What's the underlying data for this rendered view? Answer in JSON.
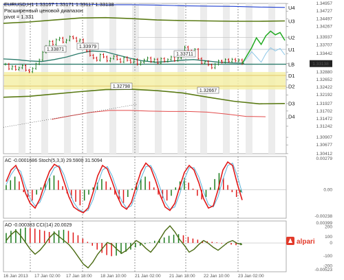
{
  "header": {
    "symbol_line": "EURUSD,H1  1.33167 1.33171 1.33117 1.33138",
    "subtitle": "Расширенный ценовой диапазон",
    "pivot_label": "pivot = 1.331"
  },
  "colors": {
    "price_up": "#1a7a1a",
    "price_down": "#cc0000",
    "forecast": "#22aa22",
    "channel_upper": "#1f3fd0",
    "channel_mid": "#5a7a14",
    "moving_average": "#2a7a6a",
    "pivot_band": "#f5f0a8",
    "red_level": "#e24a4a",
    "ac_signal": "#e01818",
    "cci_line": "#4a6a12"
  },
  "chart_data": [
    {
      "id": "price",
      "type": "line",
      "title": "EURUSD,H1",
      "ylim": [
        1.3041,
        1.3496
      ],
      "yticks": [
        "1.34957",
        "1.34727",
        "1.34497",
        "1.34267",
        "1.33937",
        "1.33707",
        "1.33442",
        "1.33138",
        "1.32880",
        "1.32652",
        "1.32422",
        "1.32192",
        "1.31927",
        "1.31702",
        "1.31472",
        "1.31242",
        "1.30907",
        "1.30677",
        "1.30412"
      ],
      "levels": [
        {
          "name": "U4",
          "value": 1.3484
        },
        {
          "name": "U3",
          "value": 1.3443
        },
        {
          "name": "U2",
          "value": 1.3393
        },
        {
          "name": "U1",
          "value": 1.3357
        },
        {
          "name": "LB",
          "value": 1.3312
        },
        {
          "name": "D1",
          "value": 1.3278
        },
        {
          "name": "D2",
          "value": 1.3246
        },
        {
          "name": "D3",
          "value": 1.3194
        },
        {
          "name": "D4",
          "value": 1.3154
        }
      ],
      "current_price": 1.33138,
      "annotations": [
        {
          "text": "1.33871",
          "value": 1.33871
        },
        {
          "text": "1.33979",
          "value": 1.33979
        },
        {
          "text": "1.33711",
          "value": 1.33711
        },
        {
          "text": "1.32798",
          "value": 1.32798
        },
        {
          "text": "1.32667",
          "value": 1.32667
        }
      ],
      "close": [
        1.3312,
        1.3298,
        1.3305,
        1.3296,
        1.3301,
        1.3308,
        1.3294,
        1.3289,
        1.3299,
        1.3313,
        1.3325,
        1.3348,
        1.3366,
        1.3381,
        1.3372,
        1.3386,
        1.3391,
        1.3379,
        1.3385,
        1.3395,
        1.3391,
        1.3382,
        1.3386,
        1.3368,
        1.3352,
        1.3339,
        1.3331,
        1.3324,
        1.3341,
        1.3334,
        1.3322,
        1.3329,
        1.3336,
        1.3327,
        1.3319,
        1.3332,
        1.3324,
        1.3318,
        1.3326,
        1.3312,
        1.3318,
        1.3325,
        1.3331,
        1.332,
        1.3327,
        1.3315,
        1.3329,
        1.3321,
        1.3326,
        1.3334,
        1.3323,
        1.3331,
        1.3348,
        1.3364,
        1.3352,
        1.3344,
        1.3357,
        1.3329,
        1.3315,
        1.332,
        1.331,
        1.3301,
        1.3312,
        1.3322,
        1.3318,
        1.3326,
        1.332,
        1.3327,
        1.3322,
        1.3325,
        1.3314
      ],
      "forecast": [
        1.3314,
        1.3338,
        1.3362,
        1.3392,
        1.3372,
        1.3398,
        1.3412,
        1.3401,
        1.3408,
        1.3384
      ],
      "forecast_alt": [
        1.3314,
        1.333,
        1.335,
        1.3334,
        1.3318,
        1.3344,
        1.3362,
        1.3352,
        1.336,
        1.334
      ],
      "upper_channel": [
        1.3493,
        1.3494,
        1.3495,
        1.3494,
        1.3492,
        1.3492,
        1.3491,
        1.3489,
        1.3488,
        1.3487,
        1.3485,
        1.3484
      ],
      "mid_channel_high": [
        1.3436,
        1.344,
        1.3446,
        1.3452,
        1.3453,
        1.345,
        1.3446,
        1.3444,
        1.3443,
        1.3442,
        1.3442,
        1.3443
      ],
      "mid_channel_low": [
        1.3212,
        1.3215,
        1.3222,
        1.3229,
        1.3235,
        1.3236,
        1.3232,
        1.3225,
        1.3212,
        1.32,
        1.3192,
        1.3193
      ],
      "red_line": [
        1.3145,
        1.3156,
        1.3166,
        1.3172,
        1.3172,
        1.317,
        1.3169,
        1.3169,
        1.3167,
        1.3161,
        1.3154,
        1.3153
      ],
      "moving_average": [
        1.3328,
        1.3326,
        1.3322,
        1.332,
        1.3326,
        1.3334,
        1.3345,
        1.3352,
        1.335,
        1.334,
        1.333,
        1.3322,
        1.3318,
        1.332,
        1.3324,
        1.3326,
        1.3322,
        1.3318,
        1.3316,
        1.3315
      ]
    },
    {
      "id": "ac_stoch",
      "type": "bar",
      "title": "AC -0.0001686  Stoch(5,3,3) 29.5900 31.5094",
      "ylim": [
        -0.00238,
        0.00279
      ],
      "yticks": [
        "0.00279",
        "0.00",
        "-0.00238"
      ],
      "histogram": [
        0.0004,
        0.0008,
        0.0011,
        0.0007,
        -0.0002,
        -0.0006,
        -0.0009,
        -0.0004,
        0.0002,
        0.0007,
        0.001,
        0.0012,
        0.0008,
        0.0003,
        -0.0003,
        -0.0007,
        -0.001,
        -0.0013,
        -0.0009,
        -0.0004,
        0.0002,
        0.0006,
        0.0009,
        0.0007,
        0.0002,
        -0.0004,
        -0.0008,
        -0.0011,
        -0.0006,
        0.0001,
        0.0006,
        0.0009,
        0.0011,
        0.0007,
        0.0002,
        -0.0004,
        -0.0007,
        -0.0009,
        -0.0005,
        0.0002,
        0.0007,
        0.001,
        0.0006,
        0.0001,
        -0.0005,
        -0.0008,
        -0.0006,
        0.0002,
        0.0009,
        0.0014,
        0.001,
        0.0004,
        -0.0002,
        -0.0006,
        -0.0002
      ],
      "stoch_main": [
        60,
        80,
        88,
        70,
        40,
        22,
        14,
        30,
        56,
        78,
        90,
        85,
        60,
        34,
        16,
        10,
        6,
        14,
        40,
        70,
        88,
        82,
        60,
        36,
        18,
        12,
        24,
        52,
        78,
        92,
        84,
        62,
        36,
        16,
        10,
        22,
        50,
        76,
        88,
        80,
        58,
        30,
        14,
        18,
        46,
        80,
        94,
        88,
        56,
        28
      ],
      "stoch_signal": [
        55,
        72,
        84,
        78,
        52,
        30,
        18,
        24,
        44,
        68,
        84,
        88,
        72,
        46,
        24,
        12,
        8,
        10,
        28,
        56,
        80,
        86,
        70,
        46,
        26,
        14,
        18,
        40,
        66,
        86,
        88,
        72,
        48,
        24,
        12,
        16,
        38,
        64,
        84,
        84,
        68,
        42,
        20,
        16,
        34,
        64,
        88,
        92,
        70,
        40
      ]
    },
    {
      "id": "ao_cci",
      "type": "bar",
      "title": "AO -0.000383  CCI(14) 20.0029",
      "ylim": [
        -0.00523,
        0.00399
      ],
      "yticks": [
        "0.00399",
        "200",
        "100",
        "0",
        "-100",
        "-200",
        "-0.00523"
      ],
      "histogram": [
        0.0018,
        0.0022,
        0.0025,
        0.0026,
        0.0028,
        0.0027,
        0.0026,
        0.0024,
        0.0022,
        0.002,
        0.0021,
        0.0023,
        0.0024,
        0.0022,
        0.0019,
        0.0014,
        0.0008,
        0.0002,
        -0.0005,
        -0.0012,
        -0.0018,
        -0.0022,
        -0.0024,
        -0.0023,
        -0.002,
        -0.0016,
        -0.0012,
        -0.0008,
        -0.0005,
        -0.0002,
        0.0001,
        0.0004,
        0.0007,
        0.001,
        0.0013,
        0.0015,
        0.0016,
        0.0014,
        0.0011,
        0.0008,
        0.0006,
        0.0004,
        0.0003,
        0.0002,
        0.0001,
        -0.0001,
        -0.0002,
        -0.0003,
        -0.0004,
        -0.0004
      ],
      "cci": [
        60,
        120,
        160,
        110,
        40,
        -30,
        -80,
        -40,
        20,
        90,
        140,
        100,
        60,
        20,
        -40,
        -110,
        -180,
        -220,
        -160,
        -80,
        -20,
        40,
        20,
        -30,
        -70,
        -40,
        10,
        60,
        30,
        -20,
        -60,
        0,
        80,
        160,
        210,
        150,
        70,
        10,
        -60,
        -30,
        20,
        60,
        30,
        -10,
        -40,
        0,
        40,
        60,
        30,
        20
      ]
    }
  ],
  "time_axis": {
    "labels": [
      "16 Jan 2013",
      "17 Jan 02:00",
      "17 Jan 18:00",
      "18 Jan 10:00",
      "21 Jan 02:00",
      "21 Jan 18:00",
      "22 Jan 10:00",
      "23 Jan 02:00"
    ]
  },
  "branding": {
    "logo_text": "alpari",
    "logo_icon": "alpari-logo-icon"
  }
}
